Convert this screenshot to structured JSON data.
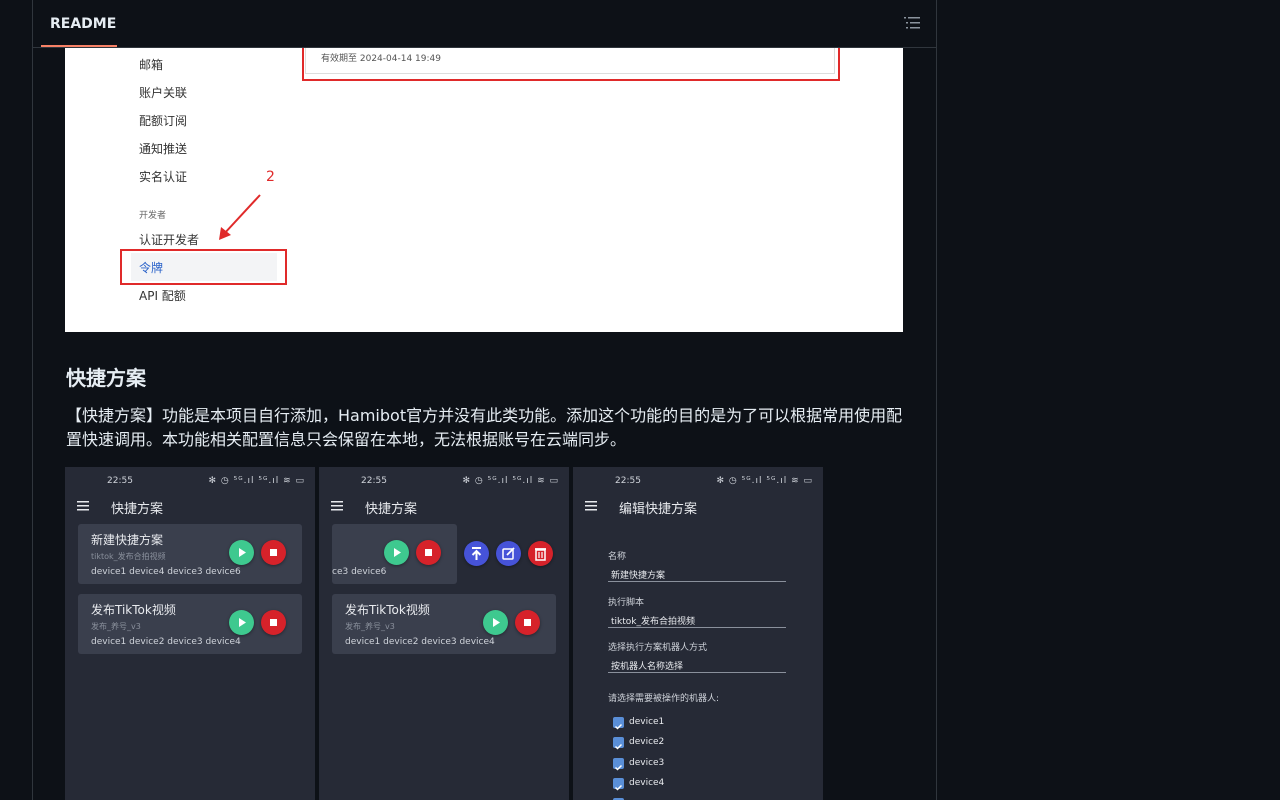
{
  "tabbar": {
    "tab_label": "README"
  },
  "shot1": {
    "expiry": "有效期至  2024-04-14 19:49",
    "menu": [
      "邮箱",
      "账户关联",
      "配额订阅",
      "通知推送",
      "实名认证"
    ],
    "group_label": "开发者",
    "menu2": [
      "认证开发者",
      "令牌",
      "API 配额"
    ],
    "annotation": "2"
  },
  "section": {
    "heading": "快捷方案",
    "paragraph": "【快捷方案】功能是本项目自行添加，Hamibot官方并没有此类功能。添加这个功能的目的是为了可以根据常用使用配置快速调用。本功能相关配置信息只会保留在本地，无法根据账号在云端同步。"
  },
  "phones": {
    "time": "22:55",
    "status_icons": "✻ ◷ ⁵ᴳ.ıl ⁵ᴳ.ıl ≋ ▭",
    "list_title": "快捷方案",
    "edit_title": "编辑快捷方案",
    "plan1": {
      "name": "新建快捷方案",
      "script": "tiktok_发布合拍视频",
      "devices": "device1 device4 device3 device6",
      "devices_partial": "ce3 device6"
    },
    "plan2": {
      "name": "发布TikTok视频",
      "script": "发布_养号_v3",
      "devices": "device1 device2 device3 device4"
    },
    "form": {
      "name_label": "名称",
      "name_value": "新建快捷方案",
      "script_label": "执行脚本",
      "script_value": "tiktok_发布合拍视频",
      "mode_label": "选择执行方案机器人方式",
      "mode_value": "按机器人名称选择",
      "robots_label": "请选择需要被操作的机器人:",
      "robots": [
        "device1",
        "device2",
        "device3",
        "device4"
      ]
    }
  }
}
